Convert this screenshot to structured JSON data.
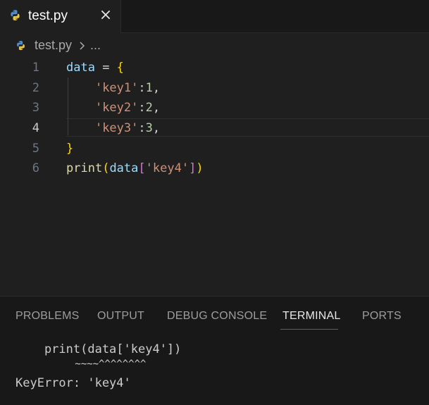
{
  "tab": {
    "filename": "test.py",
    "icon": "python-icon"
  },
  "breadcrumb": {
    "file": "test.py",
    "ellipsis": "..."
  },
  "editor": {
    "active_line": 4,
    "line_numbers": [
      "1",
      "2",
      "3",
      "4",
      "5",
      "6"
    ],
    "lines": [
      {
        "t1": "data",
        "t2": " = ",
        "t3": "{"
      },
      {
        "t1": "    ",
        "t2": "'key1'",
        "t3": ":",
        "t4": "1",
        "t5": ","
      },
      {
        "t1": "    ",
        "t2": "'key2'",
        "t3": ":",
        "t4": "2",
        "t5": ","
      },
      {
        "t1": "    ",
        "t2": "'key3'",
        "t3": ":",
        "t4": "3",
        "t5": ","
      },
      {
        "t1": "}"
      },
      {
        "t1": "print",
        "t2": "(",
        "t3": "data",
        "t4": "[",
        "t5": "'key4'",
        "t6": "]",
        "t7": ")"
      }
    ]
  },
  "panel": {
    "tabs": [
      "PROBLEMS",
      "OUTPUT",
      "DEBUG CONSOLE",
      "TERMINAL",
      "PORTS"
    ],
    "active_tab": "TERMINAL"
  },
  "terminal": {
    "line1": "    print(data['key4'])",
    "line2": "          ~~~~^^^^^^^^",
    "line3": "KeyError: 'key4'"
  },
  "colors": {
    "editor_bg": "#1f1f1f",
    "panel_bg": "#181818",
    "accent": "#0078d4",
    "string": "#ce9178",
    "variable": "#9cdcfe",
    "number": "#b5cea8",
    "function": "#dcdcaa",
    "bracket_yellow": "#ffd700",
    "bracket_purple": "#da70d6"
  }
}
